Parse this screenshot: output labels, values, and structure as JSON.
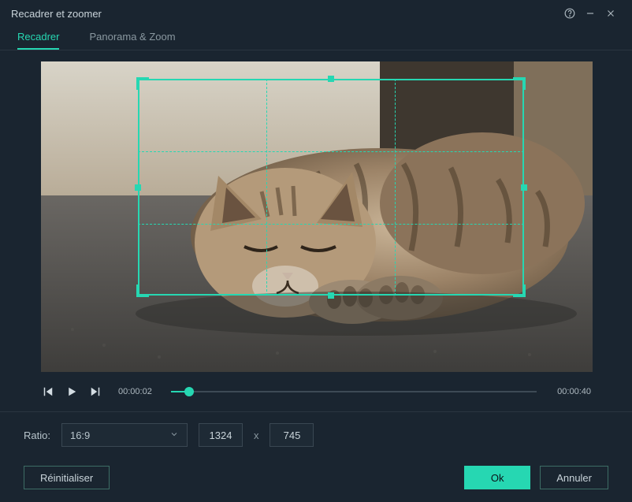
{
  "window": {
    "title": "Recadrer et zoomer"
  },
  "tabs": {
    "recadrer": "Recadrer",
    "panorama": "Panorama & Zoom",
    "active": "recadrer"
  },
  "crop": {
    "left_pct": 17.5,
    "top_pct": 5.5,
    "width_pct": 70,
    "height_pct": 70
  },
  "playback": {
    "current": "00:00:02",
    "total": "00:00:40",
    "progress_pct": 5
  },
  "ratio": {
    "label": "Ratio:",
    "value": "16:9",
    "width": "1324",
    "height": "745",
    "separator": "x"
  },
  "buttons": {
    "reset": "Réinitialiser",
    "ok": "Ok",
    "cancel": "Annuler"
  },
  "colors": {
    "accent": "#26d7b2",
    "bg": "#1a2530"
  }
}
